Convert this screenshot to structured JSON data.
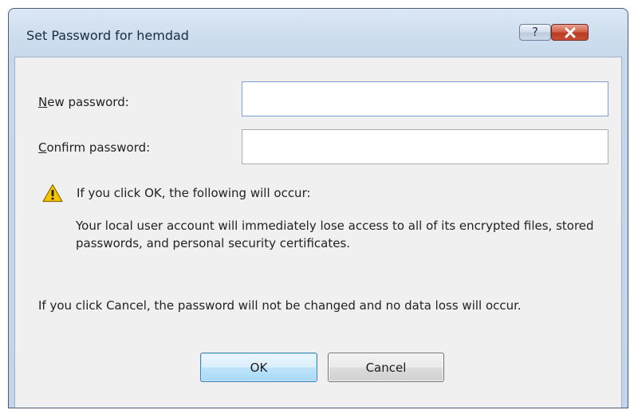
{
  "window": {
    "title": "Set Password for hemdad",
    "help_label": "?",
    "close_icon": "close-x-icon"
  },
  "form": {
    "new_password_label": "ew password:",
    "new_password_accel": "N",
    "new_password_value": "",
    "confirm_password_label": "onfirm password:",
    "confirm_password_accel": "C",
    "confirm_password_value": ""
  },
  "warning": {
    "icon": "warning-triangle-icon",
    "title": "If you click OK, the following will occur:",
    "body": "Your local user account will immediately lose access to all of its encrypted files, stored passwords, and personal security certificates."
  },
  "cancel_note": "If you click Cancel, the password will not be changed and no data loss will occur.",
  "buttons": {
    "ok_label": "OK",
    "cancel_label": "Cancel"
  },
  "colors": {
    "close_button": "#c94e36",
    "default_button": "#a8d8f7",
    "warning_yellow": "#f5c400"
  }
}
